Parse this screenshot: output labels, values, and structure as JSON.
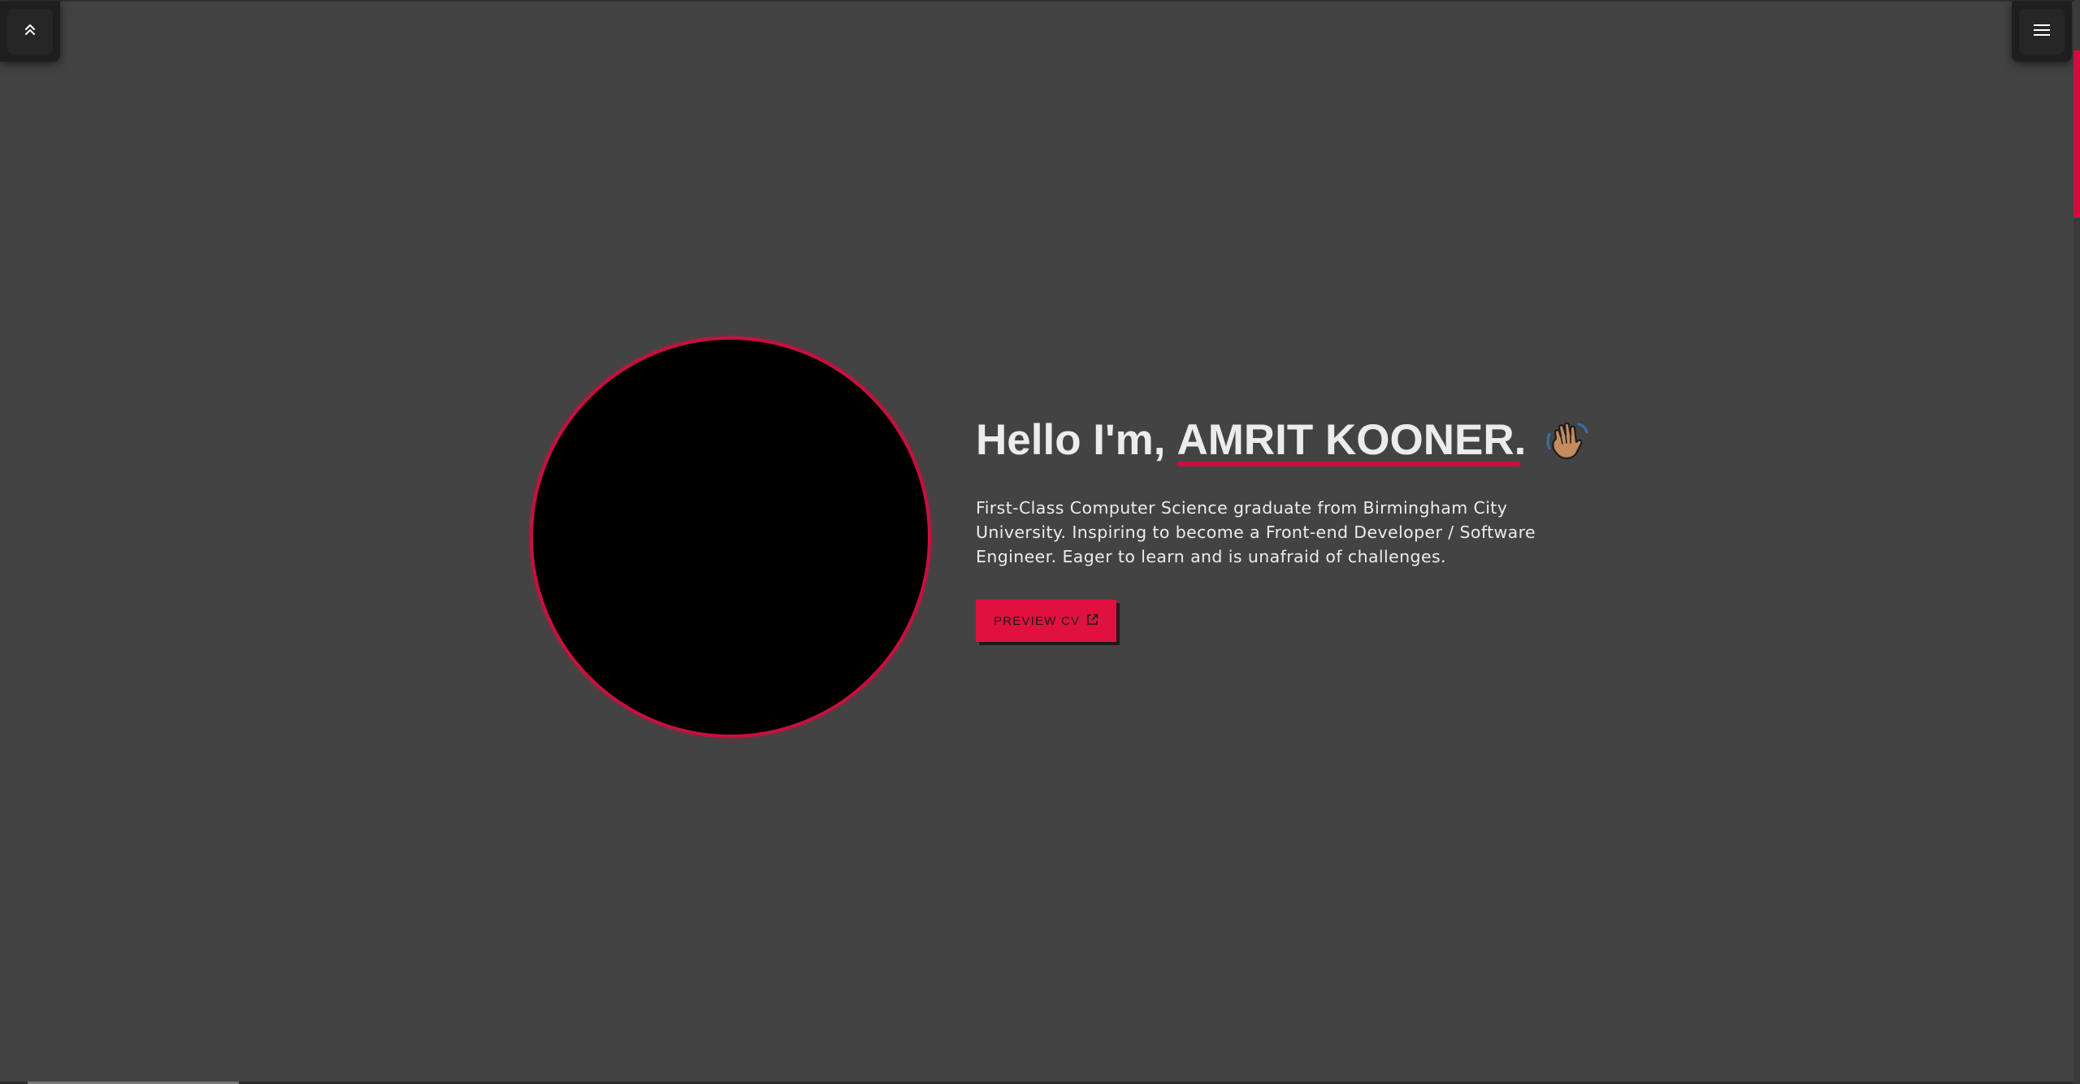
{
  "nav": {
    "scroll_top_icon": "double-chevron-up-icon",
    "menu_icon": "hamburger-menu-icon"
  },
  "hero": {
    "greeting": "Hello I'm,",
    "name": "AMRIT KOONER.",
    "wave_icon": "waving-hand-icon",
    "description": "First-Class Computer Science graduate from Birmingham City University. Inspiring to become a Front-end Developer / Software Engineer. Eager to learn and is unafraid of challenges.",
    "cv_button_label": "PREVIEW CV",
    "cv_button_icon": "external-link-icon"
  },
  "colors": {
    "background": "#434343",
    "accent": "#e0113f",
    "text": "#ececec",
    "avatar_fill": "#000000"
  }
}
